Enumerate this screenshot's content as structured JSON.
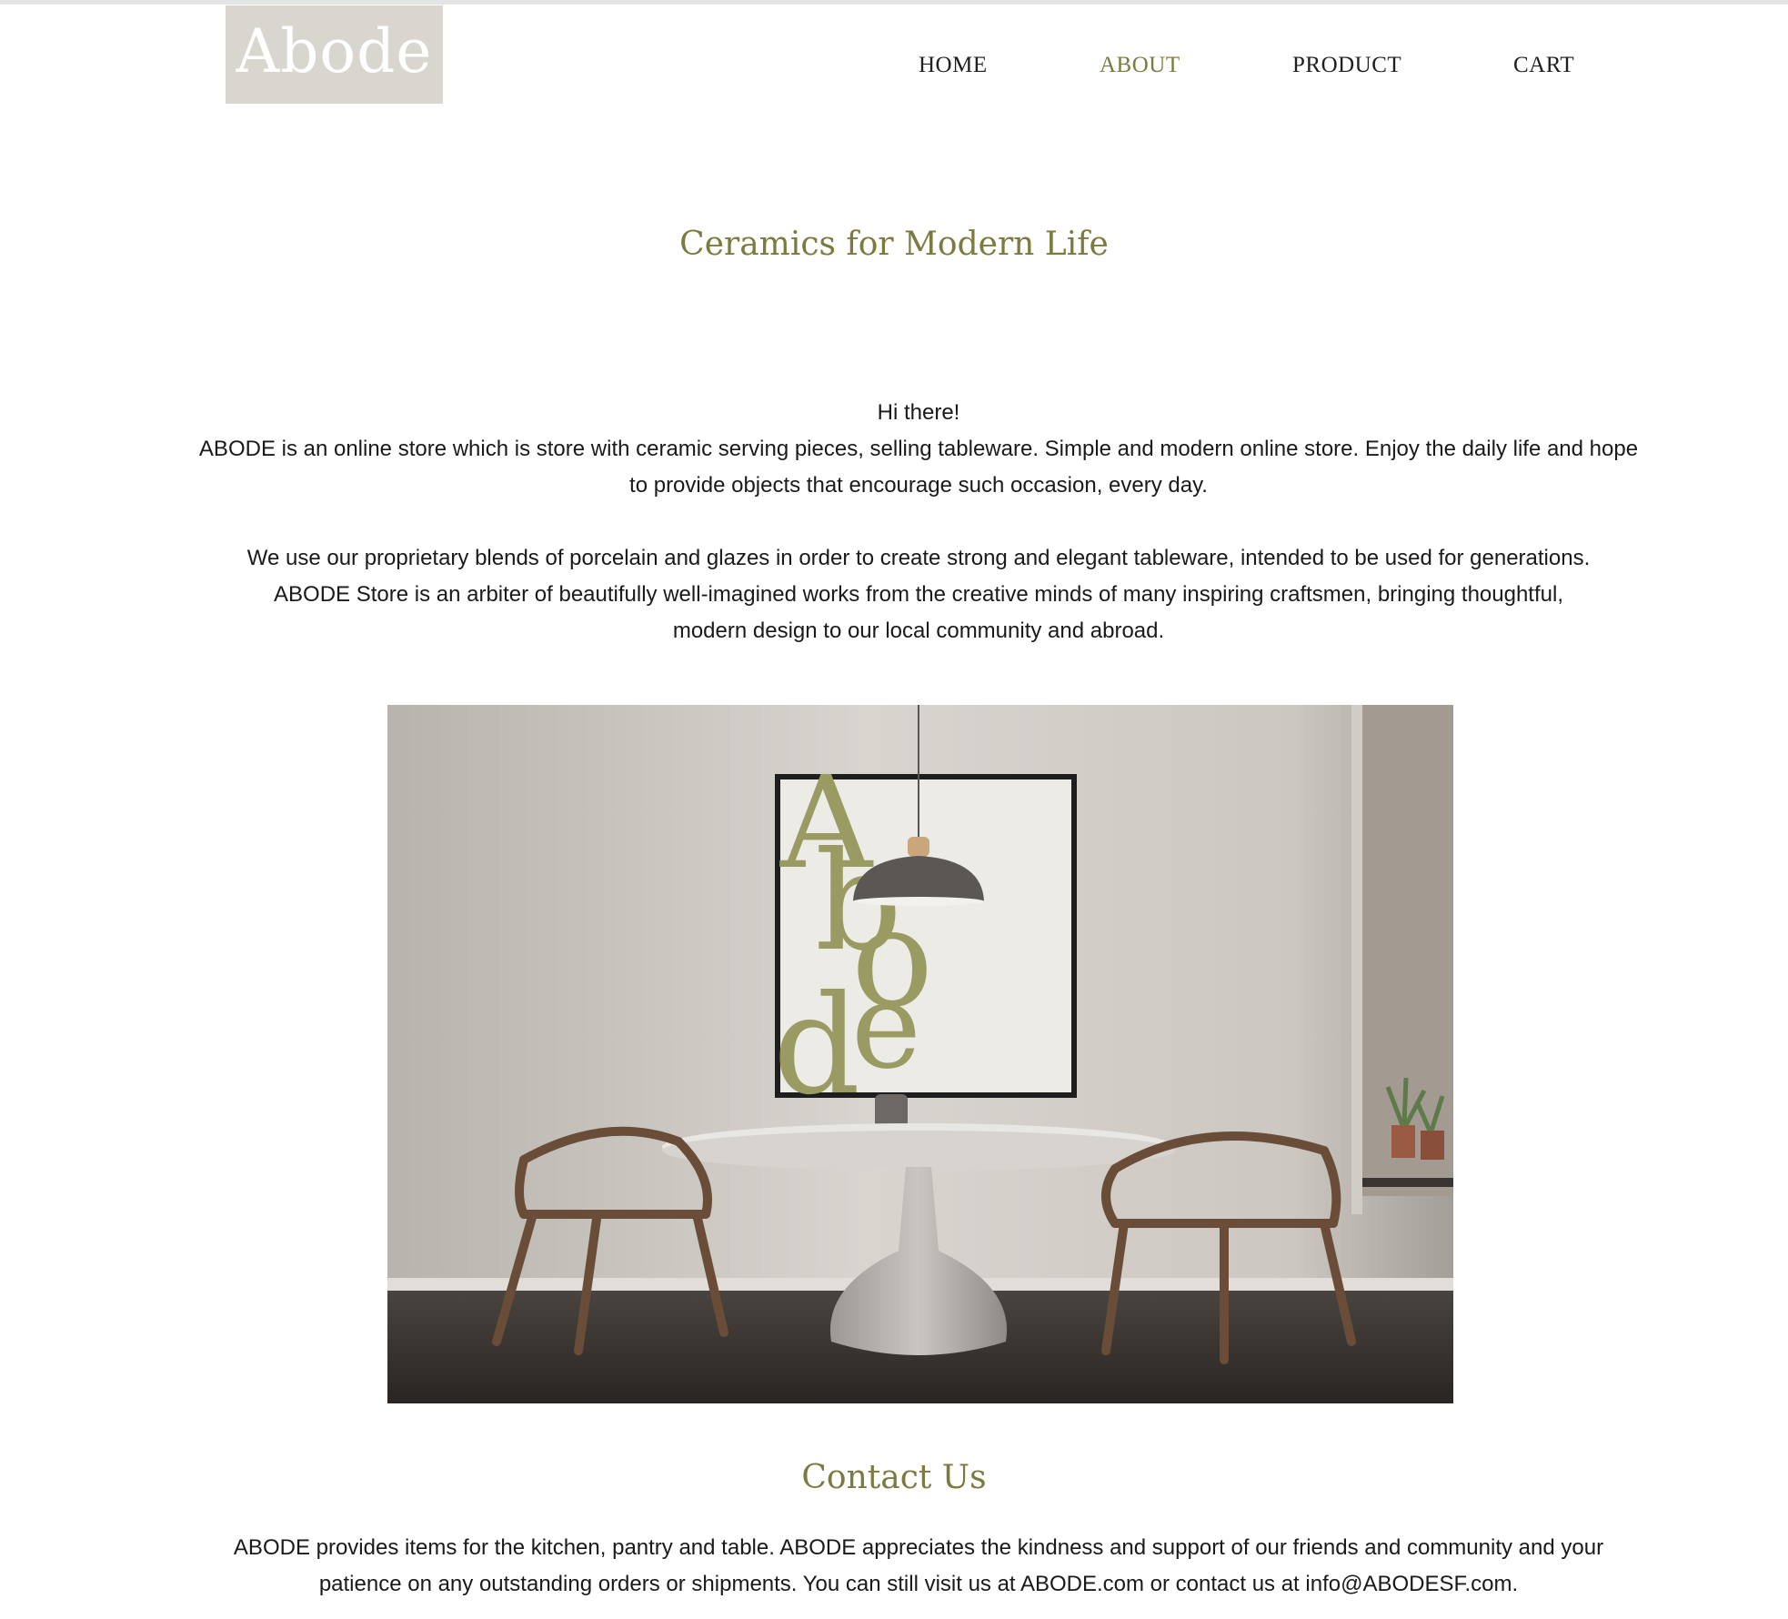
{
  "header": {
    "logo_text": "Abode",
    "nav": [
      {
        "label": "HOME",
        "active": false
      },
      {
        "label": "ABOUT",
        "active": true
      },
      {
        "label": "PRODUCT",
        "active": false
      },
      {
        "label": "CART",
        "active": false
      }
    ]
  },
  "main": {
    "title": "Ceramics for Modern Life",
    "greeting": "Hi there!",
    "paragraph1": "ABODE is an online store which is store with ceramic serving pieces, selling tableware. Simple and modern online store. Enjoy the daily life and hope to provide objects that encourage such occasion, every day.",
    "paragraph2": "We use our proprietary blends of porcelain and glazes in order to create strong and elegant tableware, intended to be used for generations. ABODE Store is an arbiter of beautifully well-imagined works from the creative minds of many inspiring craftsmen, bringing thoughtful, modern design to our local community and abroad.",
    "hero": {
      "poster_letters": [
        "A",
        "b",
        "o",
        "d",
        "e"
      ]
    }
  },
  "contact": {
    "title": "Contact Us",
    "text": "ABODE provides items for the kitchen, pantry and table. ABODE appreciates the kindness and support of our friends and community and your patience on any outstanding orders or shipments. You can still visit us at ABODE.com or contact us at info@ABODESF.com."
  },
  "colors": {
    "accent": "#7b7a3f",
    "logo_bg": "#d9d6d0",
    "text": "#1a1a1a"
  }
}
